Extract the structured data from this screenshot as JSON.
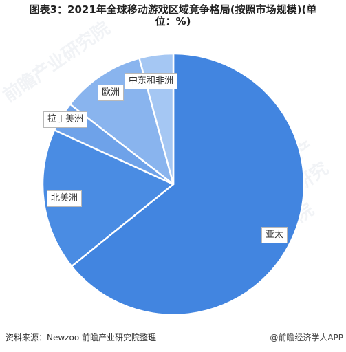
{
  "title_line1": "图表3：2021年全球移动游戏区域竞争格局(按照市场规模)(单",
  "title_line2": "位：%)",
  "chart_data": {
    "type": "pie",
    "title": "图表3：2021年全球移动游戏区域竞争格局(按照市场规模)(单位：%)",
    "unit": "%",
    "start_angle": "12 o'clock",
    "direction": "clockwise",
    "categories": [
      "亚太",
      "北美洲",
      "拉丁美洲",
      "欧洲",
      "中东和非洲"
    ],
    "values": [
      64.2,
      17.6,
      3.7,
      10.3,
      4.2
    ],
    "colors": [
      "#4285e0",
      "#4a8ce3",
      "#6ea2e9",
      "#89b4ee",
      "#a5c7f3"
    ],
    "legend": "none",
    "data_labels": "category names in boxes"
  },
  "footer": {
    "source": "资料来源：Newzoo 前瞻产业研究院整理",
    "credit": "@前瞻经济学人APP"
  },
  "watermark": "前瞻产业研究院"
}
